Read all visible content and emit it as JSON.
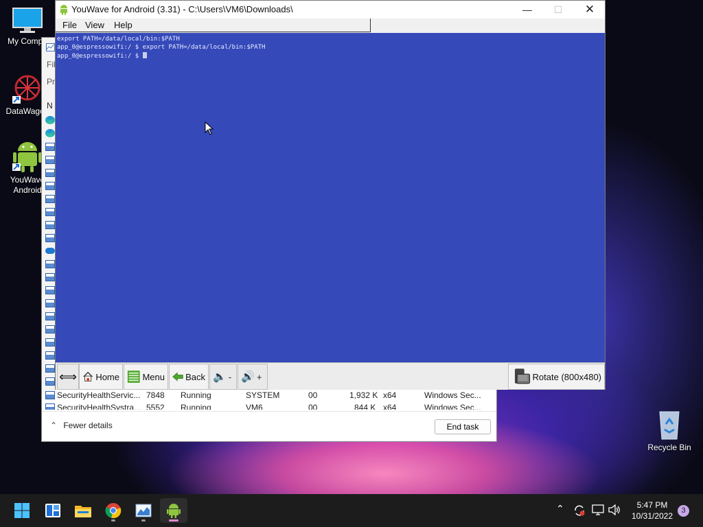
{
  "desktop": {
    "icons": [
      {
        "label": "My Compu"
      },
      {
        "label": "DataWagon"
      },
      {
        "label": "YouWave Android"
      },
      {
        "label": "Recycle Bin"
      }
    ]
  },
  "task_manager": {
    "sidebar_fragments": [
      "Fil",
      "Pr",
      "N"
    ],
    "rows": [
      {
        "name": "SecurityHealthServic...",
        "pid": "7848",
        "status": "Running",
        "user": "SYSTEM",
        "cpu": "00",
        "memory": "1,932 K",
        "arch": "x64",
        "description": "Windows Sec..."
      },
      {
        "name": "SecurityHealthSystra...",
        "pid": "5552",
        "status": "Running",
        "user": "VM6",
        "cpu": "00",
        "memory": "844 K",
        "arch": "x64",
        "description": "Windows Sec..."
      }
    ],
    "fewer_details": "Fewer details",
    "end_task": "End task"
  },
  "youwave": {
    "title": "YouWave for Android (3.31) - C:\\Users\\VM6\\Downloads\\",
    "menu": [
      {
        "label": "File"
      },
      {
        "label": "View"
      },
      {
        "label": "Help"
      }
    ],
    "terminal_lines": [
      "export PATH=/data/local/bin:$PATH",
      "app_0@espressowifi:/ $ export PATH=/data/local/bin:$PATH",
      "app_0@espressowifi:/ $ "
    ],
    "toolbar": {
      "home": "Home",
      "menu": "Menu",
      "back": "Back",
      "vol_down": "-",
      "vol_up": "+",
      "rotate": "Rotate (800x480)"
    }
  },
  "taskbar": {
    "apps": [
      {
        "icon": "windows-start-icon"
      },
      {
        "icon": "widgets-icon"
      },
      {
        "icon": "file-explorer-icon"
      },
      {
        "icon": "chrome-icon"
      },
      {
        "icon": "task-manager-icon"
      },
      {
        "icon": "youwave-icon"
      }
    ],
    "time": "5:47 PM",
    "date": "10/31/2022",
    "notifications": "3"
  }
}
